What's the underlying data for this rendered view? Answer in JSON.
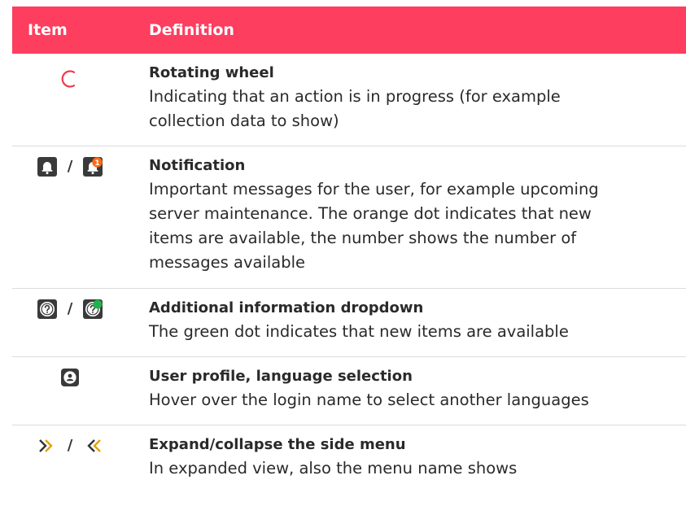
{
  "header": {
    "item": "Item",
    "definition": "Definition"
  },
  "separator": "/",
  "rows": [
    {
      "title": "Rotating wheel",
      "desc": [
        "Indicating that an action is in progress (for example",
        "collection data to show)"
      ],
      "icons": [
        "rotating-wheel-icon"
      ]
    },
    {
      "title": "Notification",
      "desc": [
        "Important messages for the user, for example upcoming",
        "server maintenance. The orange dot indicates that new",
        "items are available, the number shows the number of",
        "messages available"
      ],
      "icons": [
        "bell-icon",
        "bell-with-badge-icon"
      ],
      "badge": "1"
    },
    {
      "title": "Additional information dropdown",
      "desc": [
        "The green dot indicates that new items are available"
      ],
      "icons": [
        "question-icon",
        "question-with-dot-icon"
      ]
    },
    {
      "title": "User profile, language selection",
      "desc": [
        "Hover over the login name to select another languages"
      ],
      "icons": [
        "user-profile-icon"
      ]
    },
    {
      "title": "Expand/collapse the side menu",
      "desc": [
        "In expanded view, also the menu name shows"
      ],
      "icons": [
        "double-chevron-right-icon",
        "double-chevron-left-icon"
      ]
    }
  ],
  "colors": {
    "header": "#fd3e5f",
    "wheel": "#f03c4a",
    "icon_dark": "#3a3a3a",
    "badge_orange": "#ff6a13",
    "dot_green": "#1fb34a",
    "chevron_gold": "#e0a400"
  }
}
